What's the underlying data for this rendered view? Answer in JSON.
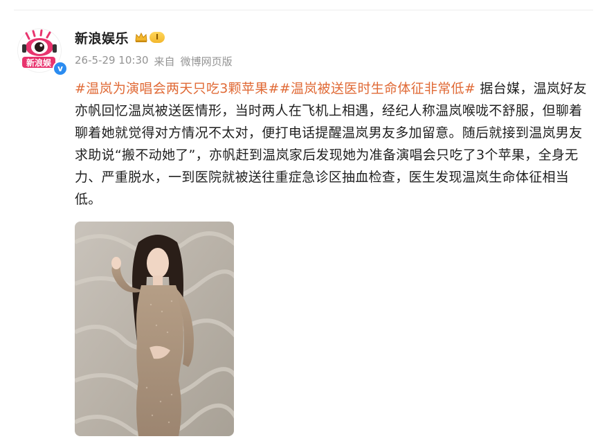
{
  "post": {
    "author": {
      "name": "新浪娱乐",
      "avatar_text": "新浪娱",
      "level": "I",
      "verified_icon": "verified-badge-icon",
      "vip_icon": "crown-icon"
    },
    "meta": {
      "time": "26-5-29 10:30",
      "source_prefix": "来自",
      "source": "微博网页版"
    },
    "hashtags": [
      "#温岚为演唱会两天只吃3颗苹果#",
      "#温岚被送医时生命体征非常低#"
    ],
    "body": " 据台媒，温岚好友亦帆回忆温岚被送医情形，当时两人在飞机上相遇，经纪人称温岚喉咙不舒服，但聊着聊着她就觉得对方情况不太对，便打电话提醒温岚男友多加留意。随后就接到温岚男友求助说“搬不动她了”，亦帆赶到温岚家后发现她为准备演唱会只吃了3个苹果，全身无力、严重脱水，一到医院就被送往重症急诊区抽血检查，医生发现温岚生命体征相当低。",
    "image": {
      "description_icon": "photo-woman-in-sequin-dress"
    }
  },
  "colors": {
    "hashtag": "#e06a36",
    "meta": "#939393",
    "text": "#1f1f1f",
    "brand_pink": "#e8336d"
  }
}
